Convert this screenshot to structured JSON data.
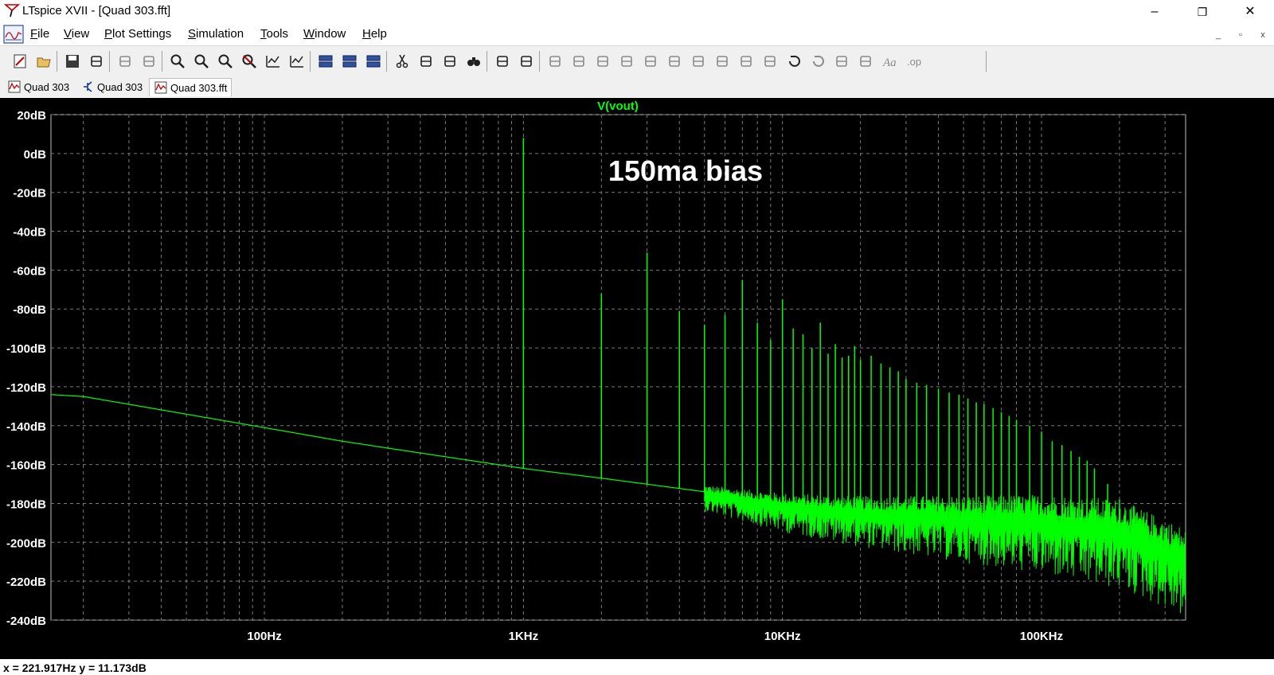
{
  "window": {
    "title": "LTspice XVII - [Quad 303.fft]",
    "controls": {
      "minimize": "–",
      "restore": "❐",
      "close": "✕"
    }
  },
  "menu": {
    "items": [
      "File",
      "View",
      "Plot Settings",
      "Simulation",
      "Tools",
      "Window",
      "Help"
    ],
    "mdi_controls": {
      "minimize": "_",
      "restore": "▫",
      "close": "x"
    }
  },
  "toolbar": {
    "icons": [
      "new-schematic-icon",
      "open-icon",
      "save-icon",
      "control-panel-icon",
      "run-icon",
      "halt-icon",
      "zoom-in-icon",
      "zoom-area-icon",
      "zoom-out-icon",
      "zoom-fit-icon",
      "autorange-icon",
      "mark-icon",
      "tile-horizontal-icon",
      "tile-vertical-icon",
      "cascade-icon",
      "cut-icon",
      "copy-icon",
      "paste-icon",
      "find-icon",
      "print-icon",
      "print-setup-icon",
      "wire-icon",
      "ground-icon",
      "label-icon",
      "resistor-icon",
      "capacitor-icon",
      "inductor-icon",
      "diode-icon",
      "component-icon",
      "move-icon",
      "drag-icon",
      "undo-icon",
      "redo-icon",
      "rotate-icon",
      "mirror-icon",
      "text-icon",
      "spice-directive-icon"
    ]
  },
  "tabs": [
    {
      "label": "Quad 303",
      "icon": "waveform-icon",
      "active": false
    },
    {
      "label": "Quad 303",
      "icon": "schematic-icon",
      "active": false
    },
    {
      "label": "Quad 303.fft",
      "icon": "waveform-icon",
      "active": true
    }
  ],
  "colors": {
    "plot_background": "#000000",
    "grid": "#7a7a7a",
    "trace": "#00ff00",
    "trace_label": "#00ff00",
    "axis_text": "#ffffff"
  },
  "chart_data": {
    "type": "line",
    "title": "V(vout)",
    "annotation": "150ma bias",
    "x_scale": "log",
    "xlim": [
      15,
      360000
    ],
    "ylim": [
      -240,
      20
    ],
    "x_ticks": [
      {
        "value": 100,
        "label": "100Hz"
      },
      {
        "value": 1000,
        "label": "1KHz"
      },
      {
        "value": 10000,
        "label": "10KHz"
      },
      {
        "value": 100000,
        "label": "100KHz"
      }
    ],
    "y_ticks": [
      {
        "value": 20,
        "label": "20dB"
      },
      {
        "value": 0,
        "label": "0dB"
      },
      {
        "value": -20,
        "label": "-20dB"
      },
      {
        "value": -40,
        "label": "-40dB"
      },
      {
        "value": -60,
        "label": "-60dB"
      },
      {
        "value": -80,
        "label": "-80dB"
      },
      {
        "value": -100,
        "label": "-100dB"
      },
      {
        "value": -120,
        "label": "-120dB"
      },
      {
        "value": -140,
        "label": "-140dB"
      },
      {
        "value": -160,
        "label": "-160dB"
      },
      {
        "value": -180,
        "label": "-180dB"
      },
      {
        "value": -200,
        "label": "-200dB"
      },
      {
        "value": -220,
        "label": "-220dB"
      },
      {
        "value": -240,
        "label": "-240dB"
      }
    ],
    "grid": true,
    "series": [
      {
        "name": "V(vout)",
        "noise_floor": {
          "x": [
            15,
            20,
            30,
            100,
            200,
            500,
            1000,
            2000,
            5000,
            10000,
            20000,
            50000,
            100000,
            200000,
            300000,
            360000
          ],
          "y": [
            -124,
            -125,
            -129,
            -141,
            -148,
            -156,
            -162,
            -167,
            -174,
            -180,
            -183,
            -185,
            -186,
            -190,
            -200,
            -205
          ]
        },
        "noise_band_start": 5000,
        "harmonic_peaks": {
          "x": [
            1000,
            2000,
            3000,
            4000,
            5000,
            6000,
            7000,
            8000,
            9000,
            10000,
            11000,
            12000,
            13000,
            14000,
            15000,
            16000,
            17000,
            18000,
            19000,
            20000,
            22000,
            24000,
            26000,
            28000,
            30000,
            33000,
            36000,
            40000,
            44000,
            48000,
            52000,
            56000,
            60000,
            65000,
            70000,
            75000,
            80000,
            90000,
            100000,
            110000,
            120000,
            130000,
            140000,
            150000,
            160000,
            180000,
            200000,
            220000,
            240000
          ],
          "y": [
            8,
            -72,
            -51,
            -81,
            -88,
            -83,
            -65,
            -87,
            -96,
            -75,
            -90,
            -93,
            -100,
            -87,
            -103,
            -98,
            -105,
            -104,
            -99,
            -106,
            -104,
            -108,
            -110,
            -112,
            -116,
            -118,
            -119,
            -121,
            -123,
            -124,
            -126,
            -128,
            -129,
            -131,
            -133,
            -135,
            -137,
            -140,
            -143,
            -148,
            -150,
            -153,
            -156,
            -158,
            -162,
            -170,
            -178,
            -183,
            -188
          ]
        }
      }
    ]
  },
  "status": {
    "cursor_readout": "x = 221.917Hz    y = 11.173dB"
  }
}
